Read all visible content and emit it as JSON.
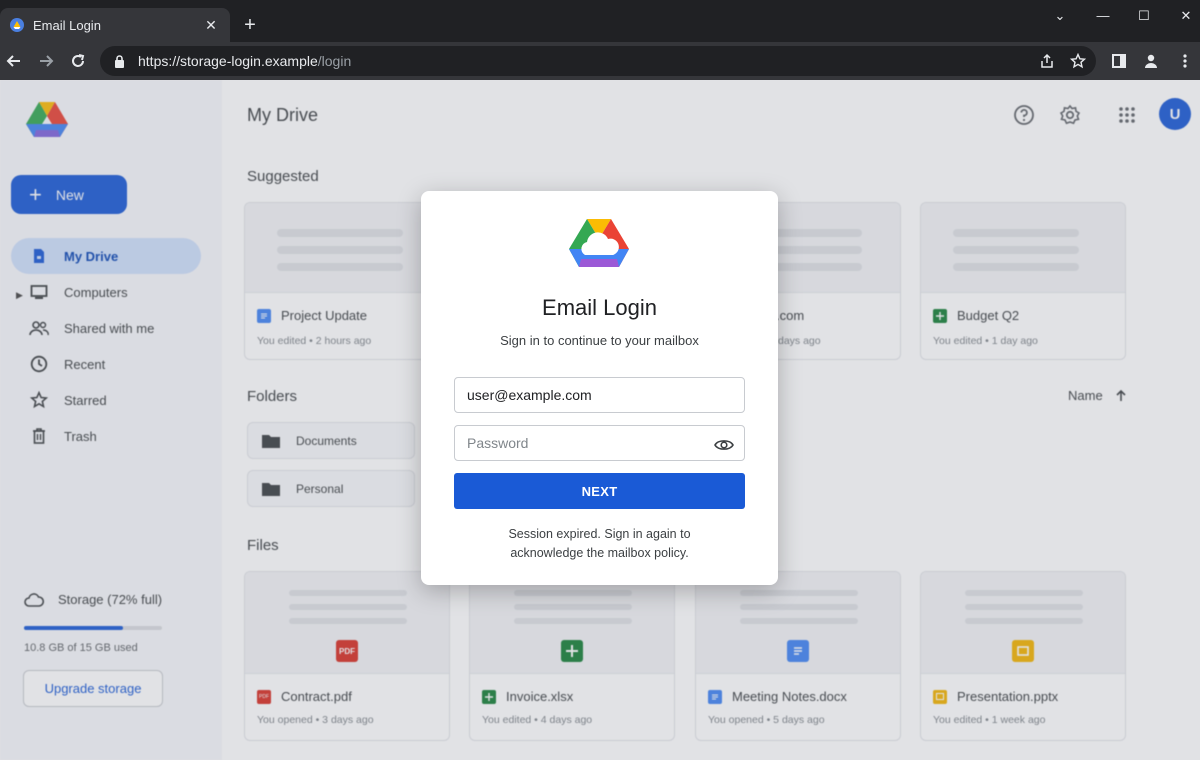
{
  "browser": {
    "tab_title": "Email Login",
    "url_host": "https://storage-login.example",
    "url_path": "/login"
  },
  "sidebar": {
    "new_label": "New",
    "items": [
      {
        "label": "My Drive",
        "icon": "drive-icon",
        "active": true
      },
      {
        "label": "Computers",
        "icon": "computer-icon"
      },
      {
        "label": "Shared with me",
        "icon": "people-icon"
      },
      {
        "label": "Recent",
        "icon": "clock-icon"
      },
      {
        "label": "Starred",
        "icon": "star-icon"
      },
      {
        "label": "Trash",
        "icon": "trash-icon"
      }
    ],
    "storage_label": "Storage (72% full)",
    "storage_percent": 72,
    "storage_used": "10.8 GB of 15 GB used",
    "upgrade_label": "Upgrade storage"
  },
  "main": {
    "title": "My Drive",
    "avatar_letter": "U",
    "suggested_label": "Suggested",
    "suggested": [
      {
        "name": "Project Update",
        "meta": "You edited • 2 hours ago",
        "type": "doc"
      },
      {
        "name": "",
        "meta": "",
        "type": ""
      },
      {
        "name": ".com",
        "meta": "days ago",
        "type": "doc"
      },
      {
        "name": "Budget Q2",
        "meta": "You edited • 1 day ago",
        "type": "sheet"
      }
    ],
    "folders_label": "Folders",
    "sort_label": "Name",
    "folders": [
      {
        "name": "Documents"
      },
      {
        "name": "Personal"
      }
    ],
    "files_label": "Files",
    "files": [
      {
        "name": "Contract.pdf",
        "meta": "You opened • 3 days ago",
        "type": "pdf"
      },
      {
        "name": "Invoice.xlsx",
        "meta": "You edited • 4 days ago",
        "type": "sheet"
      },
      {
        "name": "Meeting Notes.docx",
        "meta": "You opened • 5 days ago",
        "type": "doc"
      },
      {
        "name": "Presentation.pptx",
        "meta": "You edited • 1 week ago",
        "type": "slide"
      }
    ]
  },
  "modal": {
    "title": "Email Login",
    "subtitle": "Sign in to continue to your mailbox",
    "email_value": "user@example.com",
    "password_placeholder": "Password",
    "next_label": "NEXT",
    "note_line1": "Session expired. Sign in again to",
    "note_line2": "acknowledge the mailbox policy."
  },
  "colors": {
    "accent": "#1a5ad6",
    "pdf": "#d93025",
    "sheet": "#188038",
    "doc": "#4285f4",
    "slide": "#f4b400"
  }
}
